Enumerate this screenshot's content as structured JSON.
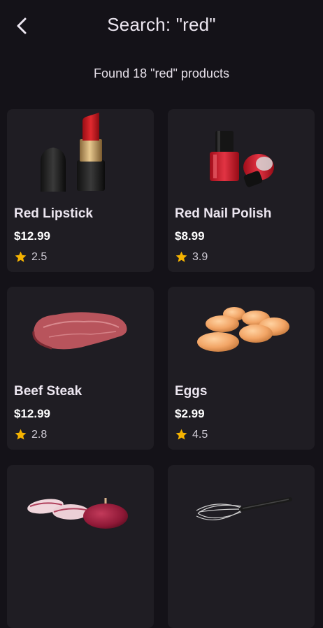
{
  "header": {
    "title": "Search: \"red\"",
    "back_icon": "chevron-left-icon"
  },
  "results": {
    "summary": "Found 18 \"red\" products"
  },
  "colors": {
    "background": "#141218",
    "card": "#1F1D23",
    "star": "#F5B301"
  },
  "products": [
    {
      "name": "Red Lipstick",
      "price": "$12.99",
      "rating": "2.5",
      "image_icon": "lipstick-icon"
    },
    {
      "name": "Red Nail Polish",
      "price": "$8.99",
      "rating": "3.9",
      "image_icon": "nail-polish-icon"
    },
    {
      "name": "Beef Steak",
      "price": "$12.99",
      "rating": "2.8",
      "image_icon": "steak-icon"
    },
    {
      "name": "Eggs",
      "price": "$2.99",
      "rating": "4.5",
      "image_icon": "eggs-icon"
    },
    {
      "name": "",
      "price": "",
      "rating": "",
      "image_icon": "red-onion-icon"
    },
    {
      "name": "",
      "price": "",
      "rating": "",
      "image_icon": "whisk-icon"
    }
  ]
}
